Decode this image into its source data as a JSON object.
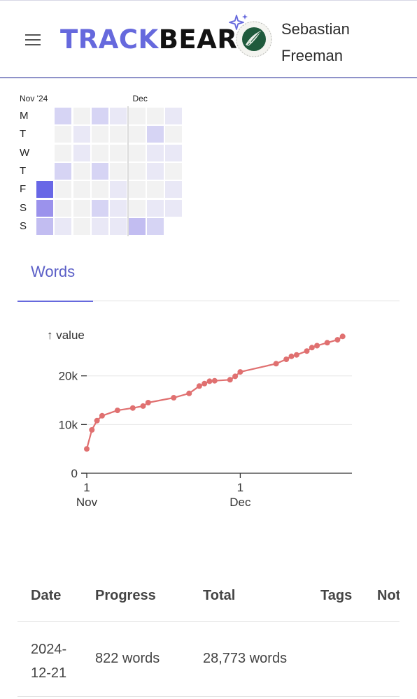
{
  "header": {
    "brand_part1": "TRACK",
    "brand_part2": "BEAR",
    "user_name_line1": "Sebastian",
    "user_name_line2": "Freeman",
    "menu_icon": "hamburger-menu-icon",
    "sparkle_icon": "sparkle-icon"
  },
  "heatmap": {
    "months": [
      {
        "label": "Nov '24",
        "col": 0
      },
      {
        "label": "Dec",
        "col": 5
      }
    ],
    "days": [
      "M",
      "T",
      "W",
      "T",
      "F",
      "S",
      "S"
    ],
    "levels": [
      [
        null,
        2,
        0,
        2,
        1,
        0,
        0,
        1
      ],
      [
        null,
        0,
        1,
        0,
        0,
        0,
        2,
        0
      ],
      [
        null,
        0,
        1,
        0,
        0,
        0,
        1,
        1
      ],
      [
        null,
        2,
        0,
        2,
        0,
        0,
        1,
        0
      ],
      [
        5,
        0,
        0,
        0,
        1,
        0,
        0,
        1
      ],
      [
        4,
        0,
        0,
        2,
        1,
        0,
        1,
        1
      ],
      [
        3,
        1,
        0,
        1,
        1,
        3,
        2,
        null
      ]
    ],
    "colors": [
      "#f2f2f2",
      "#e9e8f6",
      "#d6d4f4",
      "#c2bdf1",
      "#9b92ec",
      "#6867e6"
    ]
  },
  "tabs": {
    "active": "Words"
  },
  "chart_data": {
    "type": "line",
    "ylabel": "↑ value",
    "xlabel": "",
    "x_ticks": [
      {
        "day": 1,
        "line1": "1",
        "line2": "Nov"
      },
      {
        "day": 31,
        "line1": "1",
        "line2": "Dec"
      }
    ],
    "y_ticks": [
      {
        "value": 0,
        "label": "0"
      },
      {
        "value": 10000,
        "label": "10k"
      },
      {
        "value": 20000,
        "label": "20k"
      }
    ],
    "xlim": [
      1,
      52
    ],
    "ylim": [
      0,
      29000
    ],
    "x_unit": "day since 31 Oct 2024 (1 = Nov 1)",
    "series": [
      {
        "color": "#e07070",
        "points": [
          [
            1,
            5000
          ],
          [
            2,
            8900
          ],
          [
            3,
            10800
          ],
          [
            4,
            11800
          ],
          [
            7,
            12900
          ],
          [
            10,
            13400
          ],
          [
            12,
            13800
          ],
          [
            13,
            14500
          ],
          [
            18,
            15500
          ],
          [
            21,
            16400
          ],
          [
            23,
            17900
          ],
          [
            24,
            18400
          ],
          [
            25,
            18900
          ],
          [
            26,
            19000
          ],
          [
            29,
            19200
          ],
          [
            30,
            19900
          ],
          [
            31,
            20800
          ],
          [
            38,
            22500
          ],
          [
            40,
            23400
          ],
          [
            41,
            24000
          ],
          [
            42,
            24300
          ],
          [
            44,
            25100
          ],
          [
            45,
            25800
          ],
          [
            46,
            26200
          ],
          [
            48,
            26800
          ],
          [
            50,
            27400
          ],
          [
            51,
            28100
          ]
        ]
      }
    ]
  },
  "table": {
    "headers": [
      "Date",
      "Progress",
      "Total",
      "Tags",
      "Notes"
    ],
    "row": {
      "date_line1": "2024-",
      "date_line2": "12-21",
      "progress": "822 words",
      "total": "28,773 words"
    }
  }
}
